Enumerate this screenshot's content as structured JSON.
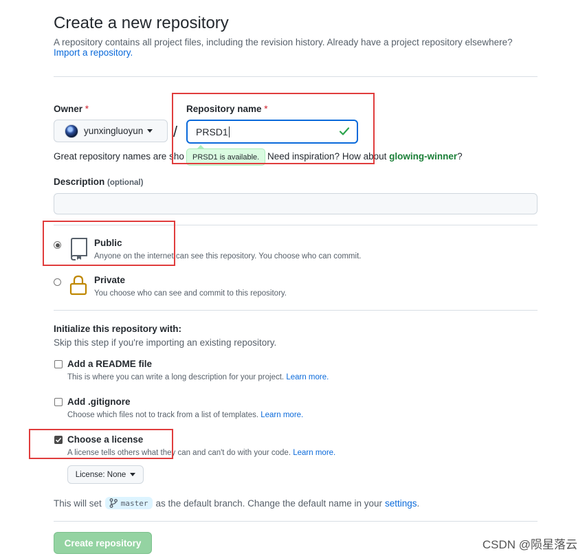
{
  "header": {
    "title": "Create a new repository",
    "subtitle": "A repository contains all project files, including the revision history. Already have a project repository elsewhere?",
    "import_link": "Import a repository."
  },
  "owner": {
    "label": "Owner",
    "required_mark": "*",
    "selected": "yunxingluoyun"
  },
  "repo_name": {
    "label": "Repository name",
    "required_mark": "*",
    "value": "PRSD1",
    "availability": "PRSD1 is available."
  },
  "helper": {
    "prefix": "Great repository names are sho",
    "middle": "Need inspiration? How about",
    "suggestion": "glowing-winner",
    "suffix": "?"
  },
  "description": {
    "label": "Description",
    "optional": "(optional)",
    "value": ""
  },
  "visibility": {
    "public": {
      "title": "Public",
      "desc": "Anyone on the internet can see this repository. You choose who can commit.",
      "selected": true
    },
    "private": {
      "title": "Private",
      "desc": "You choose who can see and commit to this repository.",
      "selected": false
    }
  },
  "initialize": {
    "title": "Initialize this repository with:",
    "subtitle": "Skip this step if you're importing an existing repository.",
    "readme": {
      "label": "Add a README file",
      "desc": "This is where you can write a long description for your project.",
      "learn_more": "Learn more.",
      "checked": false
    },
    "gitignore": {
      "label": "Add .gitignore",
      "desc": "Choose which files not to track from a list of templates.",
      "learn_more": "Learn more.",
      "checked": false
    },
    "license": {
      "label": "Choose a license",
      "desc": "A license tells others what they can and can't do with your code.",
      "learn_more": "Learn more.",
      "checked": true,
      "dropdown": "License: None"
    }
  },
  "branch": {
    "prefix": "This will set",
    "name": "master",
    "middle": "as the default branch. Change the default name in your",
    "settings_link": "settings",
    "suffix": "."
  },
  "submit": {
    "label": "Create repository"
  },
  "watermark": "CSDN @陨星落云",
  "colors": {
    "link": "#0969da",
    "success": "#1a7f37",
    "annotation_red": "#e03c3c",
    "create_button": "#94d3a2"
  }
}
